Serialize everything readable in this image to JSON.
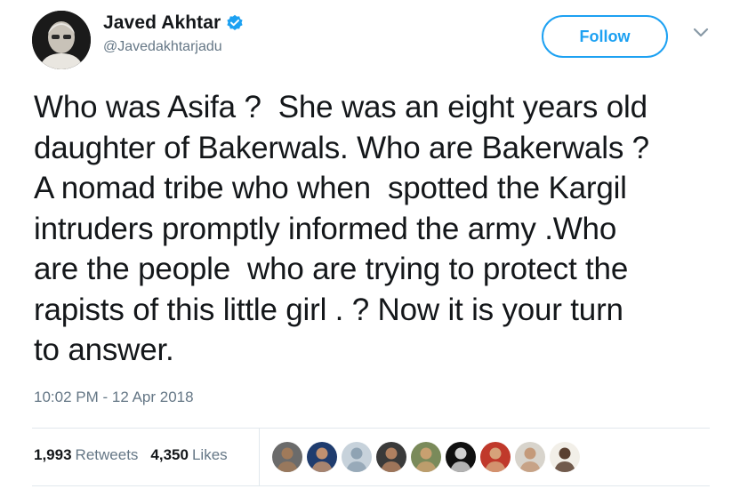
{
  "tweet": {
    "author": {
      "display_name": "Javed Akhtar",
      "handle": "@Javedakhtarjadu",
      "verified": true,
      "verified_icon": "verified-badge-icon"
    },
    "follow_label": "Follow",
    "text": "Who was Asifa ?  She was an eight years old\ndaughter of Bakerwals. Who are Bakerwals ?\nA nomad tribe who when  spotted the Kargil\nintruders promptly informed the army .Who\nare the people  who are trying to protect the\nrapists of this little girl . ? Now it is your turn\nto answer.",
    "timestamp": "10:02 PM - 12 Apr 2018",
    "stats": {
      "retweets_count": "1,993",
      "retweets_label": "Retweets",
      "likes_count": "4,350",
      "likes_label": "Likes"
    },
    "liker_avatars": [
      {
        "icon": "liker-avatar-icon",
        "color": "#6b6b6b",
        "skin": "#a07a5a"
      },
      {
        "icon": "liker-avatar-icon",
        "color": "#1f3c6e",
        "skin": "#c09070"
      },
      {
        "icon": "default-avatar-icon",
        "color": "#c7d2db",
        "skin": "#8fa3b3"
      },
      {
        "icon": "liker-avatar-icon",
        "color": "#3a3a3a",
        "skin": "#b08060"
      },
      {
        "icon": "liker-avatar-icon",
        "color": "#7a8a5a",
        "skin": "#c8a070"
      },
      {
        "icon": "liker-avatar-icon",
        "color": "#101010",
        "skin": "#d0d0d0"
      },
      {
        "icon": "liker-avatar-icon",
        "color": "#c0392b",
        "skin": "#d6a27a"
      },
      {
        "icon": "liker-avatar-icon",
        "color": "#d8d4cc",
        "skin": "#c49a7a"
      },
      {
        "icon": "liker-avatar-icon",
        "color": "#f2efe8",
        "skin": "#5a4030"
      }
    ],
    "colors": {
      "accent": "#1da1f2",
      "text_primary": "#14171a",
      "text_secondary": "#657786",
      "divider": "#e1e8ed"
    }
  }
}
